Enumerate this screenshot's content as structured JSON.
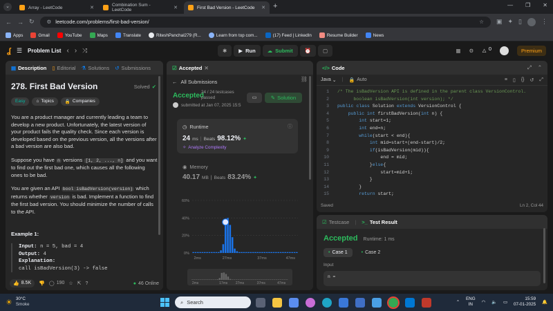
{
  "browser": {
    "tabs": [
      {
        "title": "Array - LeetCode",
        "active": false
      },
      {
        "title": "Combination Sum - LeetCode",
        "active": false
      },
      {
        "title": "First Bad Version - LeetCode",
        "active": true
      }
    ],
    "url": "leetcode.com/problems/first-bad-version/",
    "bookmarks": [
      "Apps",
      "Gmail",
      "YouTube",
      "Maps",
      "Translate",
      "RiteshPanchal279 (R...",
      "Learn from top com...",
      "(17) Feed | LinkedIn",
      "Resume Builder",
      "News"
    ]
  },
  "lcnav": {
    "problem_list": "Problem List",
    "run": "Run",
    "submit": "Submit",
    "streak": "0",
    "premium": "Premium"
  },
  "left": {
    "tabs": [
      "Description",
      "Editorial",
      "Solutions",
      "Submissions"
    ],
    "title": "278. First Bad Version",
    "solved": "Solved",
    "difficulty": "Easy",
    "topics": "Topics",
    "companies": "Companies",
    "p1": "You are a product manager and currently leading a team to develop a new product. Unfortunately, the latest version of your product fails the quality check. Since each version is developed based on the previous version, all the versions after a bad version are also bad.",
    "p2a": "Suppose you have",
    "p2_n": "n",
    "p2b": "versions",
    "p2_list": "[1, 2, ..., n]",
    "p2c": "and you want to find out the first bad one, which causes all the following ones to be bad.",
    "p3a": "You are given an API",
    "p3_api": "bool isBadVersion(version)",
    "p3b": "which returns whether",
    "p3_version": "version",
    "p3c": "is bad. Implement a function to find the first bad version. You should minimize the number of calls to the API.",
    "example_title": "Example 1:",
    "ex_input_label": "Input:",
    "ex_input": "n = 5, bad = 4",
    "ex_output_label": "Output:",
    "ex_output": "4",
    "ex_expl_label": "Explanation:",
    "ex_call": "call isBadVersion(3) -> false",
    "likes": "8.5K",
    "comments": "190",
    "online": "46 Online"
  },
  "middle": {
    "tab": "Accepted",
    "all_submissions": "All Submissions",
    "status": "Accepted",
    "testcases": "24 / 24 testcases passed",
    "submitted": "submitted at Jan 07, 2025 15:5",
    "solution_btn": "Solution",
    "runtime_label": "Runtime",
    "runtime_val": "24",
    "runtime_unit": "ms",
    "beats_label": "Beats",
    "runtime_beats": "98.12%",
    "analyze": "Analyze Complexity",
    "memory_label": "Memory",
    "memory_val": "40.17",
    "memory_unit": "MB",
    "memory_beats": "83.24%",
    "chart_y": [
      "60%",
      "40%",
      "20%",
      "0%"
    ],
    "chart_x": [
      "2ms",
      "27ms",
      "37ms",
      "47ms"
    ],
    "mini_x": [
      "2ms",
      "17ms",
      "27ms",
      "37ms",
      "47ms"
    ]
  },
  "chart_data": {
    "type": "bar",
    "title": "",
    "xlabel": "",
    "ylabel": "",
    "x_ticks": [
      "2ms",
      "27ms",
      "37ms",
      "47ms"
    ],
    "y_ticks": [
      "0%",
      "20%",
      "40%",
      "60%"
    ],
    "ylim": [
      0,
      60
    ],
    "highlight_value": "24ms",
    "series": [
      {
        "values": [
          1,
          1,
          1,
          1,
          1,
          1,
          1,
          1,
          1,
          1,
          1,
          1,
          3,
          10,
          38,
          40,
          32,
          18,
          5,
          2,
          1,
          1,
          1,
          1,
          1,
          1,
          1,
          1,
          1,
          1,
          1,
          1,
          1,
          1,
          1,
          1,
          1,
          1,
          1,
          1,
          1,
          1,
          1,
          1,
          1,
          1
        ]
      }
    ]
  },
  "editor": {
    "title": "Code",
    "language": "Java",
    "auto": "Auto",
    "lines": [
      "/* The isBadVersion API is defined in the parent class VersionControl.",
      "      boolean isBadVersion(int version); */",
      "public class Solution extends VersionControl {",
      "    public int firstBadVersion(int n) {",
      "        int start=1;",
      "        int end=n;",
      "        while(start < end){",
      "            int mid=start+(end-start)/2;",
      "            if(isBadVersion(mid)){",
      "                end = mid;",
      "            }else{",
      "                start=mid+1;",
      "            }",
      "        }",
      "        return start;",
      "    }",
      "}"
    ],
    "saved": "Saved",
    "position": "Ln 2, Col 44"
  },
  "testpanel": {
    "tab1": "Testcase",
    "tab2": "Test Result",
    "status": "Accepted",
    "runtime": "Runtime: 1 ms",
    "case1": "Case 1",
    "case2": "Case 2",
    "input_label": "Input",
    "input_val": "n ="
  },
  "taskbar": {
    "temp": "30°C",
    "weather": "Smoke",
    "search": "Search",
    "lang": "ENG",
    "region": "IN",
    "time": "15:59",
    "date": "07-01-2025"
  }
}
